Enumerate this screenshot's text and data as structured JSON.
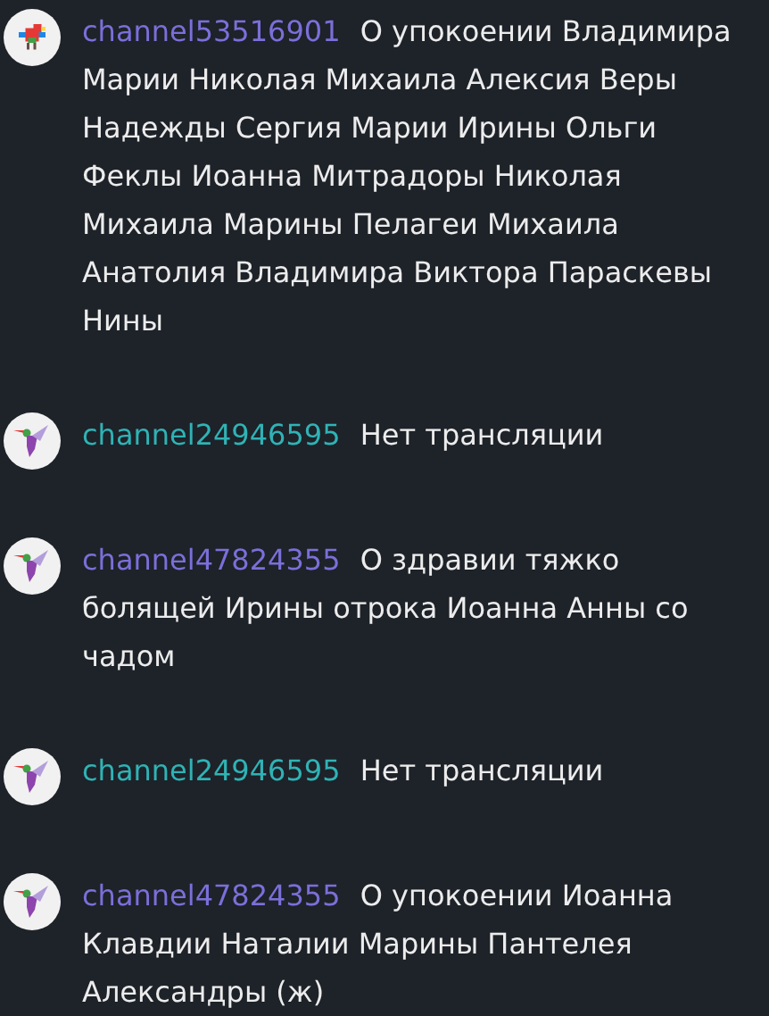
{
  "messages": [
    {
      "avatar": {
        "kind": "parrot"
      },
      "username": "channel53516901",
      "color": "#7b6fd9",
      "text": "О упокоении Владимира Марии Николая Михаила Алексия Веры Надежды Сергия Марии Ирины Ольги Феклы Иоанна Митрадоры Николая Михаила Марины Пелагеи Михаила Анатолия Владимира Виктора Параскевы Нины"
    },
    {
      "avatar": {
        "kind": "hummingbird"
      },
      "username": "channel24946595",
      "color": "#2fb3b5",
      "text": "Нет трансляции"
    },
    {
      "avatar": {
        "kind": "hummingbird"
      },
      "username": "channel47824355",
      "color": "#7b6fd9",
      "text": "О здравии тяжко болящей Ирины отрока Иоанна Анны со чадом"
    },
    {
      "avatar": {
        "kind": "hummingbird"
      },
      "username": "channel24946595",
      "color": "#2fb3b5",
      "text": "Нет трансляции"
    },
    {
      "avatar": {
        "kind": "hummingbird"
      },
      "username": "channel47824355",
      "color": "#7b6fd9",
      "text": "О упокоении Иоанна Клавдии Наталии Марины Пантелея Александры (ж)"
    }
  ]
}
